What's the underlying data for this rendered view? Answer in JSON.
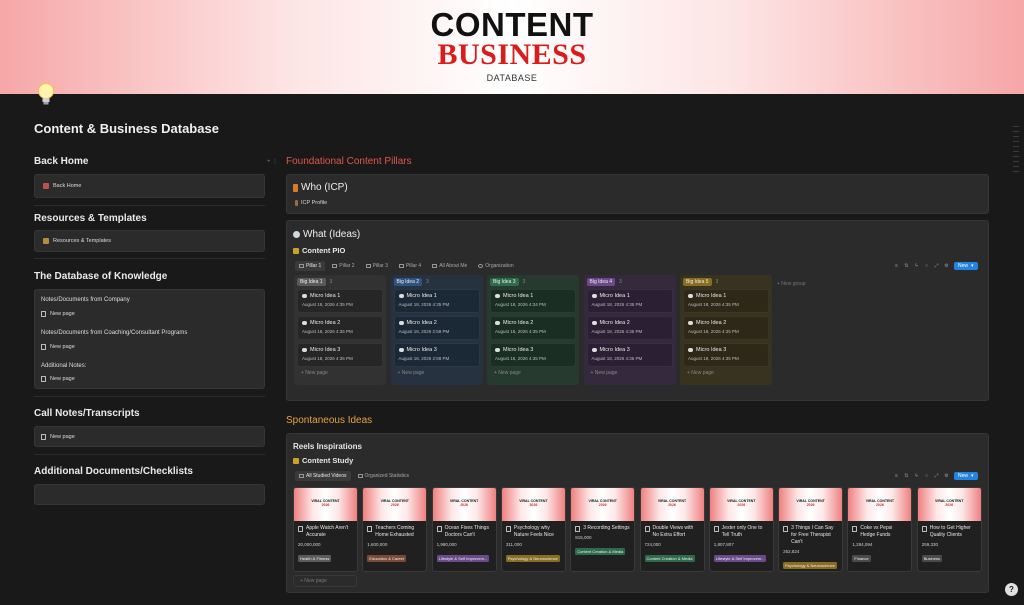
{
  "cover": {
    "title_line1": "CONTENT",
    "title_line2": "BUSINESS",
    "title_line3": "DATABASE"
  },
  "page": {
    "title": "Content & Business Database"
  },
  "left": {
    "back_home": {
      "heading": "Back Home",
      "link": "Back Home"
    },
    "resources": {
      "heading": "Resources & Templates",
      "link": "Resources & Templates"
    },
    "knowledge": {
      "heading": "The Database of Knowledge",
      "groups": [
        {
          "label": "Notes/Documents from Company",
          "page": "New page"
        },
        {
          "label": "Notes/Documents from Coaching/Consultant Programs",
          "page": "New page"
        },
        {
          "label": "Additional Notes:",
          "page": "New page"
        }
      ]
    },
    "call_notes": {
      "heading": "Call Notes/Transcripts",
      "page": "New page"
    },
    "additional_docs": {
      "heading": "Additional Documents/Checklists"
    }
  },
  "foundational": {
    "heading": "Foundational Content Pillars",
    "who": {
      "title": "Who (ICP)",
      "link": "ICP Profile"
    },
    "what": {
      "title": "What (Ideas)",
      "db_title": "Content PIO",
      "tabs": [
        "Pillar 1",
        "Pillar 2",
        "Pillar 3",
        "Pillar 4",
        "All About Me",
        "Organization"
      ],
      "new_label": "New",
      "add_group": "+ New group",
      "columns": [
        {
          "name": "Big Idea 1",
          "count": "3",
          "bg": "#323232",
          "card_bg": "#262626",
          "badge": "#5a5a5a",
          "cards": [
            {
              "title": "Micro Idea 1",
              "date": "August 18, 2026 4:35 PM"
            },
            {
              "title": "Micro Idea 2",
              "date": "August 18, 2026 4:35 PM"
            },
            {
              "title": "Micro Idea 3",
              "date": "August 18, 2026 4:35 PM"
            }
          ],
          "new_page": "+ New page"
        },
        {
          "name": "Big Idea 2",
          "count": "3",
          "bg": "#26323f",
          "card_bg": "#1b2836",
          "badge": "#2f5480",
          "cards": [
            {
              "title": "Micro Idea 1",
              "date": "August 18, 2026 4:35 PM"
            },
            {
              "title": "Micro Idea 2",
              "date": "August 18, 2026 2:58 PM"
            },
            {
              "title": "Micro Idea 3",
              "date": "August 18, 2026 2:58 PM"
            }
          ],
          "new_page": "+ New page"
        },
        {
          "name": "Big Idea 3",
          "count": "3",
          "bg": "#263a30",
          "card_bg": "#1b2e24",
          "badge": "#2d6b4b",
          "cards": [
            {
              "title": "Micro Idea 1",
              "date": "August 18, 2026 4:34 PM"
            },
            {
              "title": "Micro Idea 2",
              "date": "August 18, 2026 4:35 PM"
            },
            {
              "title": "Micro Idea 3",
              "date": "August 18, 2026 4:35 PM"
            }
          ],
          "new_page": "+ New page"
        },
        {
          "name": "Big Idea 4",
          "count": "3",
          "bg": "#352a3d",
          "card_bg": "#2a1f33",
          "badge": "#6c4a8a",
          "cards": [
            {
              "title": "Micro Idea 1",
              "date": "August 18, 2026 4:35 PM"
            },
            {
              "title": "Micro Idea 2",
              "date": "August 18, 2026 4:35 PM"
            },
            {
              "title": "Micro Idea 3",
              "date": "August 18, 2026 4:35 PM"
            }
          ],
          "new_page": "+ New page"
        },
        {
          "name": "Big Idea 5",
          "count": "3",
          "bg": "#38331f",
          "card_bg": "#2d2817",
          "badge": "#8a6c23",
          "cards": [
            {
              "title": "Micro Idea 1",
              "date": "August 18, 2026 4:35 PM"
            },
            {
              "title": "Micro Idea 2",
              "date": "August 18, 2026 4:35 PM"
            },
            {
              "title": "Micro Idea 3",
              "date": "August 18, 2026 4:35 PM"
            }
          ],
          "new_page": "+ New page"
        }
      ]
    }
  },
  "spontaneous": {
    "heading": "Spontaneous Ideas",
    "box_title": "Reels Inspirations",
    "db_title": "Content Study",
    "tabs": [
      "All Studied Videos",
      "Organized Statistics"
    ],
    "new_label": "New",
    "thumb_line1": "VIRAL CONTENT",
    "thumb_line2": "2026",
    "cards": [
      {
        "title": "Apple Watch Aren't Accurate",
        "views": "20,000,000",
        "tag": "Health & Fitness",
        "tag_color": "#5a5a5a"
      },
      {
        "title": "Teachers Coming Home Exhausted",
        "views": "1,600,000",
        "tag": "Education & Career",
        "tag_color": "#7a4b33"
      },
      {
        "title": "Ocean Fixes Things Doctors Can't",
        "views": "1,980,000",
        "tag": "Lifestyle & Self Improvem...",
        "tag_color": "#6b4a8c"
      },
      {
        "title": "Psychology why Nature Feels Nice",
        "views": "311,000",
        "tag": "Psychology & Neuroscience",
        "tag_color": "#8a6c23"
      },
      {
        "title": "3 Recording Settings",
        "views": "815,000",
        "tag": "Content Creation & Media",
        "tag_color": "#2d6b4b"
      },
      {
        "title": "Double Views with No Extra Effort",
        "views": "724,000",
        "tag": "Content Creation & Media",
        "tag_color": "#2d6b4b"
      },
      {
        "title": "Jester only One to Tell Truth",
        "views": "1,807,807",
        "tag": "Lifestyle & Self Improvem...",
        "tag_color": "#6b4a8c"
      },
      {
        "title": "3 Things I Can Say for Free Therapist Can't",
        "views": "252,824",
        "tag": "Psychology & Neuroscience",
        "tag_color": "#8a6c23"
      },
      {
        "title": "Coke vs Pepsi Hedge Funds",
        "views": "1,284,094",
        "tag": "Finance",
        "tag_color": "#4a4a4a"
      },
      {
        "title": "How to Get Higher Quality Clients",
        "views": "259,330",
        "tag": "Business",
        "tag_color": "#4a4a4a"
      }
    ],
    "new_page": "+ New page"
  },
  "help": {
    "label": "?"
  }
}
